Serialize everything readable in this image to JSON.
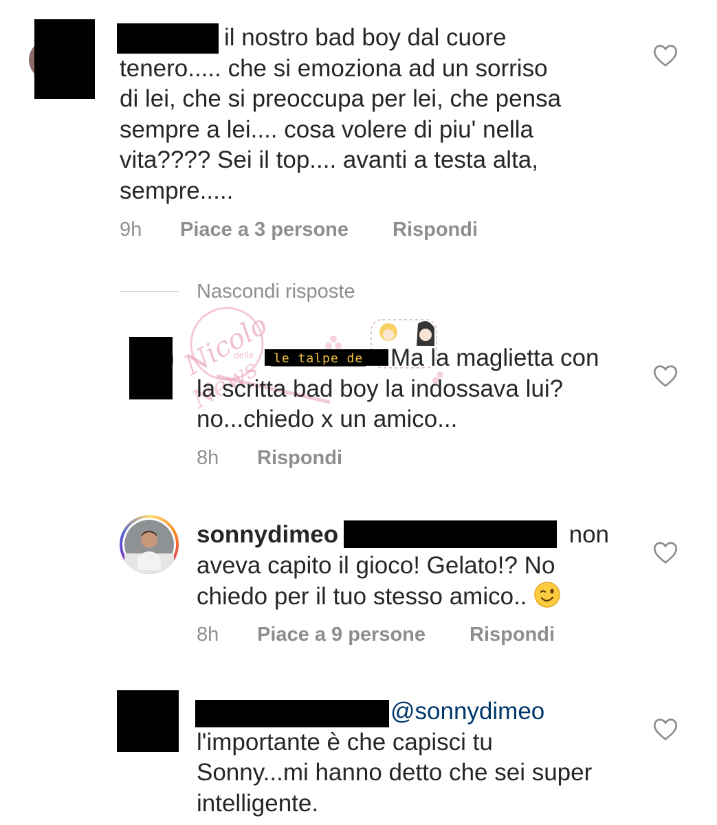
{
  "comments": [
    {
      "text": "il nostro bad boy dal cuore tenero..... che si emoziona ad un sorriso di lei, che si preoccupa per lei, che pensa sempre a lei.... cosa volere di piu' nella vita???? Sei il top.... avanti a testa alta, sempre.....",
      "lines": [
        "il nostro bad boy dal cuore",
        "tenero..... che si emoziona ad un sorriso",
        "di lei, che si preoccupa per lei, che pensa",
        "sempre a lei.... cosa volere di piu' nella",
        "vita???? Sei il top.... avanti a testa alta,",
        "sempre....."
      ],
      "time": "9h",
      "likes": "Piace a 3 persone",
      "reply": "Rispondi"
    }
  ],
  "thread": {
    "hide_replies": "Nascondi risposte"
  },
  "replies": [
    {
      "lines": [
        "Ma la maglietta con",
        "la scritta bad boy la indossava lui?",
        "no...chiedo x un amico..."
      ],
      "time": "8h",
      "reply": "Rispondi"
    },
    {
      "username": "sonnydimeo",
      "lines": [
        "non",
        "aveva capito il gioco! Gelato!? No",
        "chiedo per il tuo stesso amico.."
      ],
      "emoji": "winking-face",
      "time": "8h",
      "likes": "Piace a 9 persone",
      "reply": "Rispondi"
    },
    {
      "mention": "@sonnydimeo",
      "lines": [
        "l'importante è che capisci tu",
        "Sonny...mi hanno detto che sei super",
        "intelligente."
      ]
    }
  ],
  "watermark": {
    "text_main": "Nicolo",
    "text_small": "delle",
    "text_news": "News",
    "banner": "le talpe de"
  },
  "icons": {
    "like": "heart-outline-icon"
  },
  "colors": {
    "text": "#262626",
    "meta": "#8e8e8e",
    "mention": "#00376b",
    "redaction": "#000000",
    "watermark_pink": "#e8a0b8"
  }
}
